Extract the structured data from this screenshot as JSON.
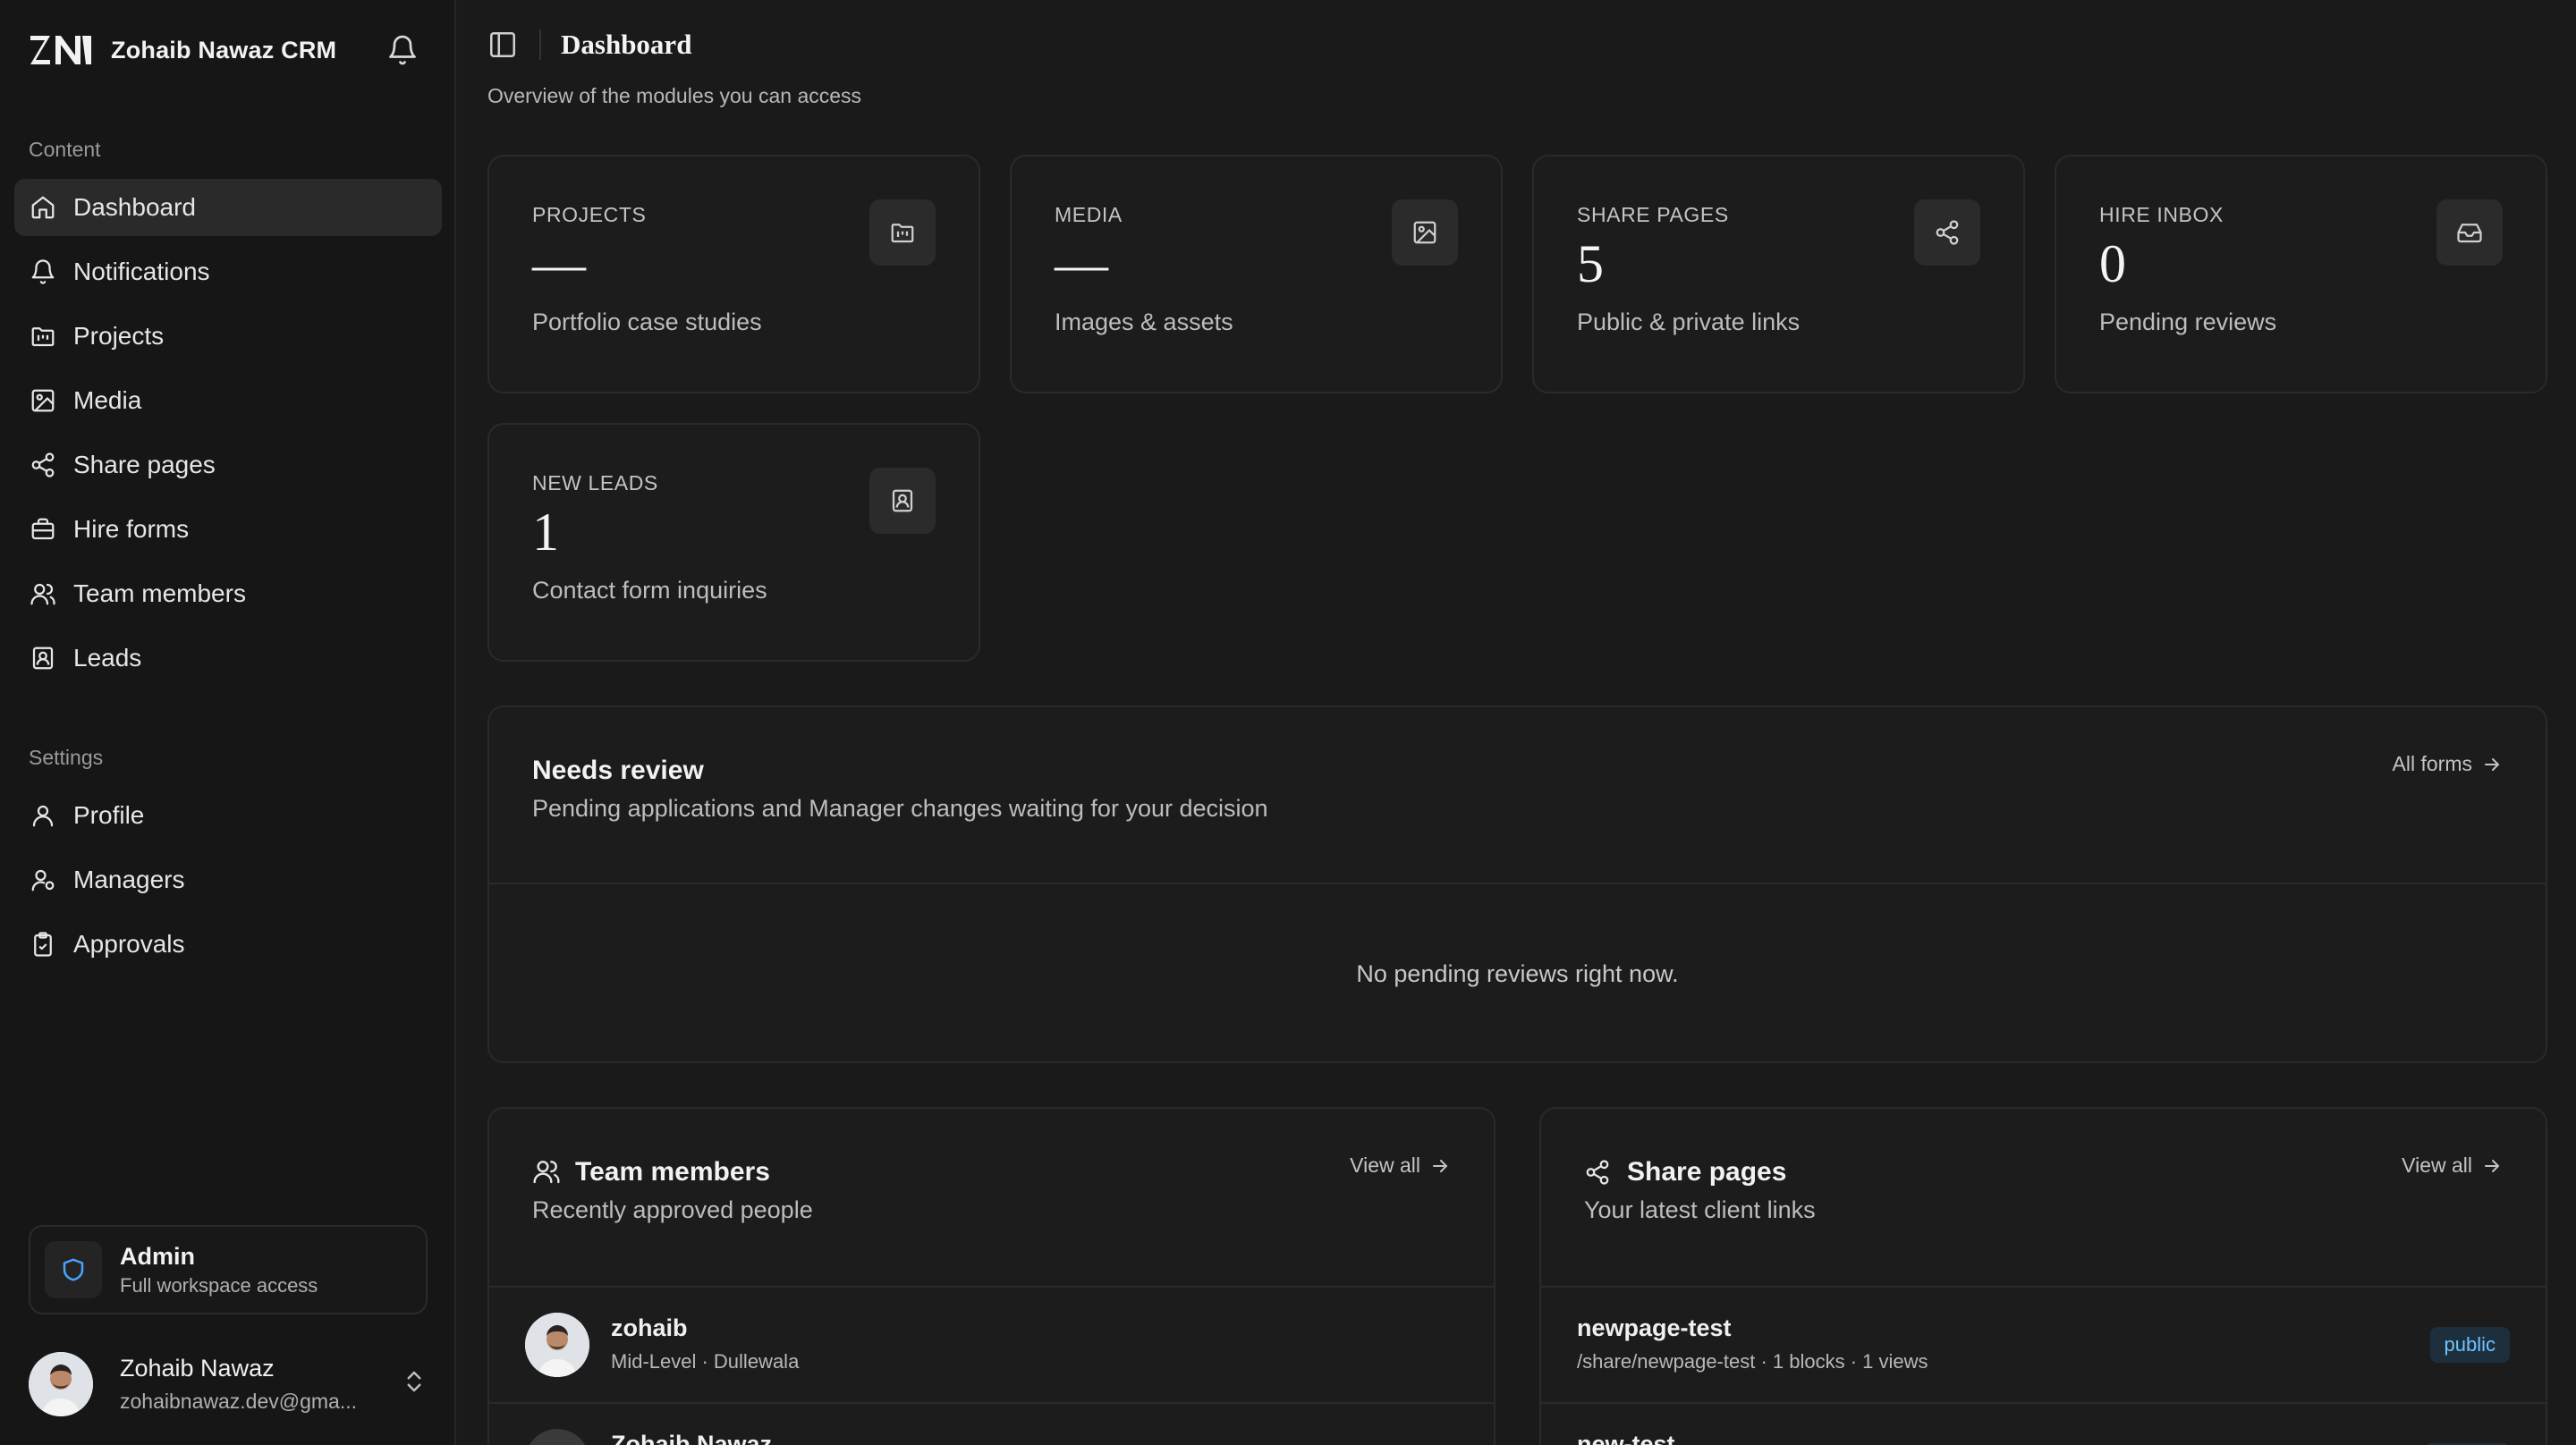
{
  "app": {
    "brand_mark": "ZN",
    "brand_name": "Zohaib Nawaz CRM"
  },
  "sidebar": {
    "content_label": "Content",
    "content_items": [
      {
        "label": "Dashboard",
        "icon": "home-icon",
        "active": true
      },
      {
        "label": "Notifications",
        "icon": "bell-icon"
      },
      {
        "label": "Projects",
        "icon": "folder-kanban-icon"
      },
      {
        "label": "Media",
        "icon": "image-icon"
      },
      {
        "label": "Share pages",
        "icon": "share-icon"
      },
      {
        "label": "Hire forms",
        "icon": "briefcase-icon"
      },
      {
        "label": "Team members",
        "icon": "users-icon"
      },
      {
        "label": "Leads",
        "icon": "contact-icon"
      }
    ],
    "settings_label": "Settings",
    "settings_items": [
      {
        "label": "Profile",
        "icon": "user-icon"
      },
      {
        "label": "Managers",
        "icon": "user-cog-icon"
      },
      {
        "label": "Approvals",
        "icon": "clipboard-check-icon"
      }
    ],
    "role_card": {
      "title": "Admin",
      "subtitle": "Full workspace access"
    },
    "user": {
      "name": "Zohaib Nawaz",
      "email": "zohaibnawaz.dev@gma..."
    }
  },
  "header": {
    "title": "Dashboard",
    "subtitle": "Overview of the modules you can access"
  },
  "stats": [
    {
      "label": "PROJECTS",
      "value": "—",
      "description": "Portfolio case studies",
      "icon": "folder-kanban-icon"
    },
    {
      "label": "MEDIA",
      "value": "—",
      "description": "Images & assets",
      "icon": "image-icon"
    },
    {
      "label": "SHARE PAGES",
      "value": "5",
      "description": "Public & private links",
      "icon": "share-icon"
    },
    {
      "label": "HIRE INBOX",
      "value": "0",
      "description": "Pending reviews",
      "icon": "inbox-icon"
    },
    {
      "label": "NEW LEADS",
      "value": "1",
      "description": "Contact form inquiries",
      "icon": "contact-icon"
    }
  ],
  "needs_review": {
    "title": "Needs review",
    "subtitle": "Pending applications and Manager changes waiting for your decision",
    "link": "All forms",
    "empty": "No pending reviews right now."
  },
  "team_members": {
    "title": "Team members",
    "subtitle": "Recently approved people",
    "link": "View all",
    "rows": [
      {
        "name": "zohaib",
        "meta": "Mid-Level · Dullewala"
      },
      {
        "name": "Zohaib Nawaz",
        "meta": ""
      }
    ]
  },
  "share_pages": {
    "title": "Share pages",
    "subtitle": "Your latest client links",
    "link": "View all",
    "rows": [
      {
        "name": "newpage-test",
        "meta": "/share/newpage-test · 1 blocks · 1 views",
        "badge": "public"
      },
      {
        "name": "new-test",
        "meta": ""
      }
    ]
  },
  "colors": {
    "background": "#1a1a1a",
    "sidebar": "#161616",
    "card": "#1c1c1c",
    "badge_text": "#6fc3ff",
    "shield": "#4aa3ff"
  }
}
